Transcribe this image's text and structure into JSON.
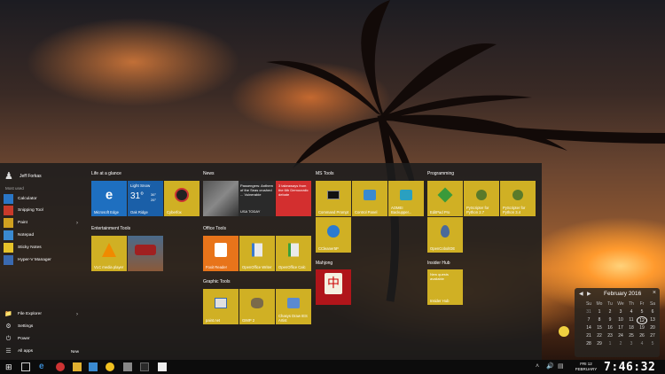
{
  "start_menu": {
    "user_name": "Jeff Forkas",
    "most_used_label": "Most used",
    "apps": [
      {
        "label": "Calculator",
        "color": "#2a76c6"
      },
      {
        "label": "Snipping Tool",
        "color": "#c83a2a"
      },
      {
        "label": "Paint",
        "color": "#d0a020"
      },
      {
        "label": "Notepad",
        "color": "#3a8ad0"
      },
      {
        "label": "Sticky Notes",
        "color": "#e6c32a"
      },
      {
        "label": "Hyper-V Manager",
        "color": "#3a6ab0"
      }
    ],
    "bottom": {
      "file_explorer": "File Explorer",
      "settings": "Settings",
      "power": "Power",
      "all_apps": "All apps",
      "new_badge": "New"
    }
  },
  "groups": {
    "life": "Life at a glance",
    "entertainment": "Entertainment Tools",
    "news": "News",
    "office": "Office Tools",
    "graphic": "Graphic Tools",
    "ms_tools": "MS Tools",
    "mahjong": "Mahjong",
    "programming": "Programming",
    "insider": "Insider Hub"
  },
  "tiles": {
    "edge": "Microsoft Edge",
    "weather_condition": "Light Snow",
    "weather_temp": "31°",
    "weather_hi": "36°",
    "weather_lo": "26°",
    "weather_city": "Oak Ridge",
    "cyberfox": "Cyberfox",
    "vlc": "VLC media player",
    "news_headline": "Passengers: Anthem of the Seas crushed ... Vulnerable",
    "news_source": "USA TODAY",
    "news_red": "3 takeaways from the 6th Democratic debate",
    "foxit": "Foxit Reader",
    "writer": "OpenOffice Writer",
    "calc": "OpenOffice Calc",
    "paintnet": "paint.net",
    "gimp": "GIMP 2",
    "chasys": "Chasys Draw IES Artist",
    "cmd": "Command Prompt",
    "control_panel": "Control Panel",
    "aomei": "AOMEI Backupper...",
    "ccleaner": "CCleaner5P",
    "editpad": "EditPad Pro",
    "pyscripter27": "PyScripter for Python 2.7",
    "pyscripter34": "PyScripter for Python 3.4",
    "openembed": "OpenCobolIDE",
    "insider_text": "New quests available",
    "insider_label": "Insider Hub"
  },
  "calendar": {
    "month": "February 2016",
    "dow": [
      "Su",
      "Mo",
      "Tu",
      "We",
      "Th",
      "Fr",
      "Sa"
    ],
    "rows": [
      [
        "31",
        "1",
        "2",
        "3",
        "4",
        "5",
        "6"
      ],
      [
        "7",
        "8",
        "9",
        "10",
        "11",
        "12",
        "13"
      ],
      [
        "14",
        "15",
        "16",
        "17",
        "18",
        "19",
        "20"
      ],
      [
        "21",
        "22",
        "23",
        "24",
        "25",
        "26",
        "27"
      ],
      [
        "28",
        "29",
        "1",
        "2",
        "3",
        "4",
        "5"
      ]
    ],
    "today": "12"
  },
  "clock": {
    "time": "7:46:32",
    "day_line": "FRI 12",
    "month_line": "FEBRUARY"
  },
  "colors": {
    "accent_gold": "#d0b024",
    "edge_blue": "#1e6fc0",
    "news_red": "#d32f2f",
    "orange": "#e8741a"
  }
}
